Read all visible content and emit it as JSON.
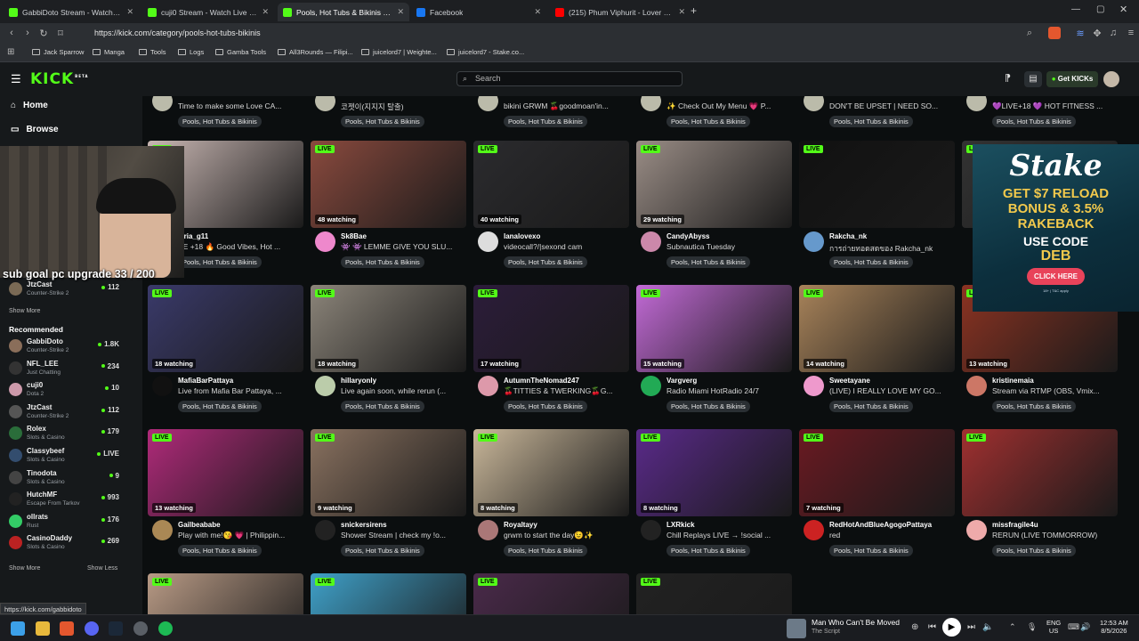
{
  "browser": {
    "tabs": [
      {
        "label": "GabbiDoto Stream - Watch Live o",
        "active": false,
        "color": "#53fc18"
      },
      {
        "label": "cuji0 Stream - Watch Live on Kick",
        "active": false,
        "color": "#53fc18"
      },
      {
        "label": "Pools, Hot Tubs & Bikinis Stream",
        "active": true,
        "color": "#53fc18"
      },
      {
        "label": "Facebook",
        "active": false,
        "color": "#1877f2"
      },
      {
        "label": "(215) Phum Viphurit - Lover Boy",
        "active": false,
        "color": "#ff0000"
      }
    ],
    "url": "https://kick.com/category/pools-hot-tubs-bikinis",
    "bookmarks": [
      "Jack Sparrow",
      "Manga",
      "Tools",
      "Logs",
      "Gamba Tools",
      "All3Rounds — Filipi...",
      "juicelord7 | Weighte...",
      "juicelord7 - Stake.co..."
    ]
  },
  "kick": {
    "logo": "KICK",
    "logo_beta": "BETA",
    "search_placeholder": "Search",
    "get_kicks": "Get KICKs",
    "accent": "#53fc18"
  },
  "sidebar": {
    "home": "Home",
    "browse": "Browse",
    "following": [
      {
        "name": "JtzCast",
        "game": "Counter-Strike 2",
        "viewers": "112",
        "color": "#7a6a55"
      }
    ],
    "show_more_top": "Show More",
    "recommended_label": "Recommended",
    "recommended": [
      {
        "name": "GabbiDoto",
        "game": "Counter-Strike 2",
        "viewers": "1.8K",
        "color": "#8a6e5a"
      },
      {
        "name": "NFL_LEE",
        "game": "Just Chatting",
        "viewers": "234",
        "color": "#333"
      },
      {
        "name": "cuji0",
        "game": "Dota 2",
        "viewers": "10",
        "color": "#c9a"
      },
      {
        "name": "JtzCast",
        "game": "Counter-Strike 2",
        "viewers": "112",
        "color": "#555"
      },
      {
        "name": "Rolex",
        "game": "Slots & Casino",
        "viewers": "179",
        "color": "#2a6d3a"
      },
      {
        "name": "Classybeef",
        "game": "Slots & Casino",
        "viewers": "LIVE",
        "color": "#334d6e"
      },
      {
        "name": "Tinodota",
        "game": "Slots & Casino",
        "viewers": "9",
        "color": "#444"
      },
      {
        "name": "HutchMF",
        "game": "Escape From Tarkov",
        "viewers": "993",
        "color": "#222"
      },
      {
        "name": "ollrats",
        "game": "Rust",
        "viewers": "176",
        "color": "#3c6"
      },
      {
        "name": "CasinoDaddy",
        "game": "Slots & Casino",
        "viewers": "269",
        "color": "#b22"
      }
    ],
    "show_more": "Show More",
    "show_less": "Show Less"
  },
  "category_tag": "Pools, Hot Tubs & Bikinis",
  "live_label": "LIVE",
  "top_row": [
    {
      "title": "Time to make some Love CA..."
    },
    {
      "title": "코젯이(지지지 탈출)"
    },
    {
      "title": "bikini GRWM 🍒goodmoan'in..."
    },
    {
      "title": "✨ Check Out My Menu 💗 P..."
    },
    {
      "title": "DON'T BE UPSET | NEED SO..."
    },
    {
      "title": "💜LIVE+18 💜 HOT FITNESS ..."
    }
  ],
  "rows": [
    [
      {
        "name": "leria_g11",
        "title": "VE +18 🔥 Good Vibes, Hot ...",
        "watching": "",
        "thumb": "#c9b7b3",
        "avatar": "#d2a"
      },
      {
        "name": "Sk8Bae",
        "title": "👾 👾 LEMME GIVE YOU SLU...",
        "watching": "48 watching",
        "thumb": "#8a4a3e",
        "avatar": "#e8c"
      },
      {
        "name": "lanalovexo",
        "title": "videocall?/|sexond cam",
        "watching": "40 watching",
        "thumb": "#2b2b2e",
        "avatar": "#ddd"
      },
      {
        "name": "CandyAbyss",
        "title": "Subnautica Tuesday",
        "watching": "29 watching",
        "thumb": "#9a8d86",
        "avatar": "#c8a"
      },
      {
        "name": "Rakcha_nk",
        "title": "การถ่ายทอดสดของ Rakcha_nk",
        "watching": "",
        "thumb": "#111",
        "avatar": "#69c"
      },
      {
        "name": "",
        "title": "",
        "watching": "",
        "thumb": "#333",
        "avatar": "#444"
      }
    ],
    [
      {
        "name": "MafiaBarPattaya",
        "title": "Live from Mafia Bar Pattaya, ...",
        "watching": "18 watching",
        "thumb": "#3a3a6a",
        "avatar": "#111"
      },
      {
        "name": "hillaryonly",
        "title": "Live again soon, while rerun (...",
        "watching": "18 watching",
        "thumb": "#8c857a",
        "avatar": "#bca"
      },
      {
        "name": "AutumnTheNomad247",
        "title": "🍒TITTIES & TWERKING🍒G...",
        "watching": "17 watching",
        "thumb": "#2c1c3a",
        "avatar": "#d9a"
      },
      {
        "name": "Vargverg",
        "title": "Radio Miami HotRadio 24/7",
        "watching": "15 watching",
        "thumb": "#c26ad6",
        "avatar": "#2a5"
      },
      {
        "name": "Sweetayane",
        "title": "(LIVE) I REALLY LOVE MY GO...",
        "watching": "14 watching",
        "thumb": "#a8835a",
        "avatar": "#e9c"
      },
      {
        "name": "kristinemaia",
        "title": "Stream via RTMP (OBS, Vmix...",
        "watching": "13 watching",
        "thumb": "#8c3322",
        "avatar": "#c76"
      }
    ],
    [
      {
        "name": "Gailbeababe",
        "title": "Play with me!😘 💗 | Philippin...",
        "watching": "13 watching",
        "thumb": "#b02a7a",
        "avatar": "#a85"
      },
      {
        "name": "snickersirens",
        "title": "Shower Stream | check my !o...",
        "watching": "9 watching",
        "thumb": "#8a7260",
        "avatar": "#222"
      },
      {
        "name": "Royaltayy",
        "title": "grwm to start the day😉✨",
        "watching": "8 watching",
        "thumb": "#c9b79a",
        "avatar": "#a77"
      },
      {
        "name": "LXRkick",
        "title": "Chill Replays LIVE → !social ...",
        "watching": "8 watching",
        "thumb": "#5a2a8a",
        "avatar": "#222"
      },
      {
        "name": "RedHotAndBlueAgogoPattaya",
        "title": "red",
        "watching": "7 watching",
        "thumb": "#6a1a22",
        "avatar": "#c22"
      },
      {
        "name": "missfragile4u",
        "title": "RERUN (LIVE TOMMORROW)",
        "watching": "",
        "thumb": "#a03030",
        "avatar": "#eaa"
      }
    ]
  ],
  "bottom_row_thumbs": [
    "#b89a85",
    "#3fa0c8",
    "#4a2a4a",
    "#222"
  ],
  "ad": {
    "brand": "Stake",
    "line1": "GET $7 RELOAD",
    "line2": "BONUS & 3.5%",
    "line3": "RAKEBACK",
    "use_code": "USE CODE",
    "code": "DEB",
    "cta": "CLICK HERE",
    "fine": "18+ | T&C apply"
  },
  "overlay": {
    "sub_goal": "sub goal pc upgrade 33 / 200"
  },
  "status_url": "https://kick.com/gabbidoto",
  "taskbar": {
    "media_title": "Man Who Can't Be Moved",
    "media_artist": "The Script",
    "lang1": "ENG",
    "lang2": "US",
    "time": "12:53 AM",
    "date": "8/5/2026"
  }
}
